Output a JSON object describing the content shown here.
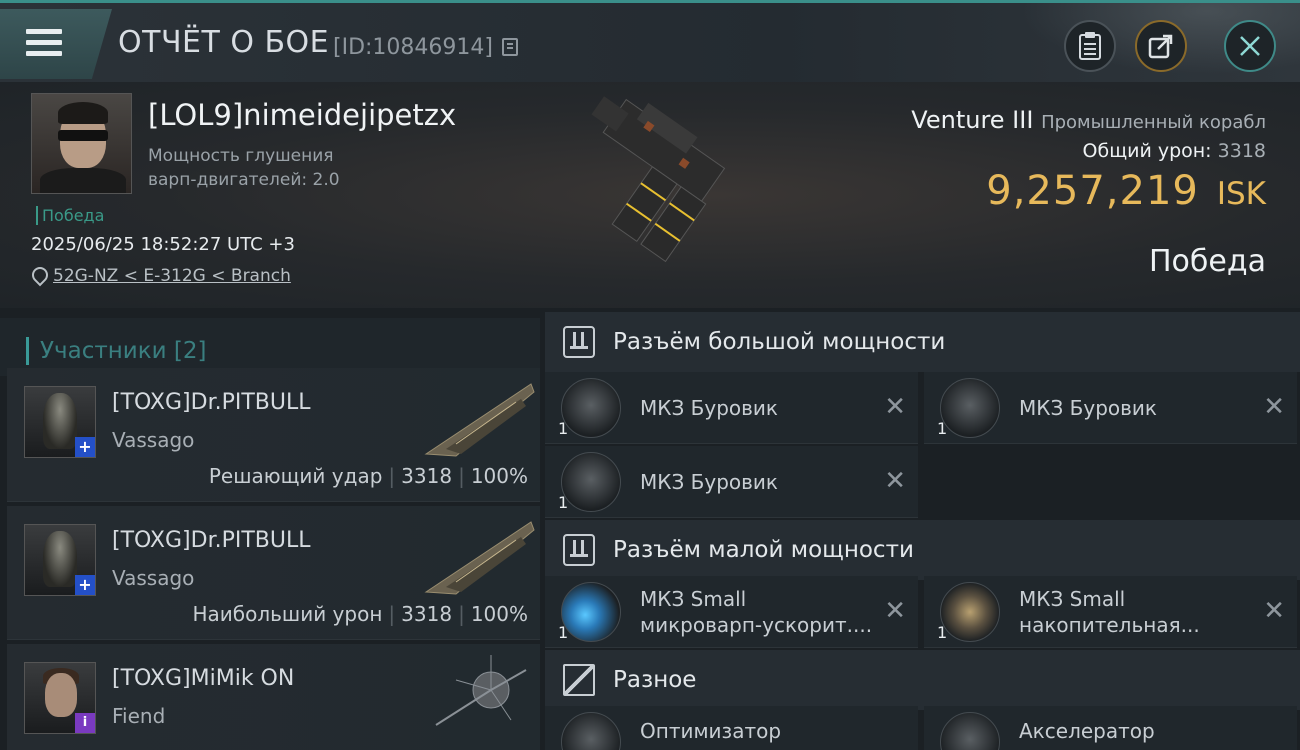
{
  "header": {
    "title": "ОТЧЁТ О БОЕ",
    "report_id": "[ID:10846914]"
  },
  "victim": {
    "name": "[LOL9]nimeidejipetzx",
    "attribute_line1": "Мощность глушения",
    "attribute_line2": "варп-двигателей: 2.0",
    "status_tag": "Победа",
    "datetime": "2025/06/25 18:52:27 UTC +3",
    "location": "52G-NZ < E-312G < Branch",
    "ship_name": "Venture III",
    "ship_class": "Промышленный корабл",
    "total_damage_label": "Общий урон:",
    "total_damage_value": "3318",
    "isk_value": "9,257,219",
    "isk_currency": "ISK",
    "result": "Победа"
  },
  "participants": {
    "title": "Участники [2]",
    "list": [
      {
        "name": "[TOXG]Dr.PITBULL",
        "ship": "Vassago",
        "role": "Решающий удар",
        "damage": "3318",
        "percent": "100%",
        "badge": "+",
        "badge_color": "#2450c8"
      },
      {
        "name": "[TOXG]Dr.PITBULL",
        "ship": "Vassago",
        "role": "Наибольший урон",
        "damage": "3318",
        "percent": "100%",
        "badge": "+",
        "badge_color": "#2450c8"
      },
      {
        "name": "[TOXG]MiMik ON",
        "ship": "Fiend",
        "badge": "i",
        "badge_color": "#7a3ac0"
      }
    ]
  },
  "fitting": {
    "high_slots": {
      "title": "Разъём большой мощности",
      "modules": [
        {
          "name": "МКЗ Буровик",
          "qty": "1"
        },
        {
          "name": "МКЗ Буровик",
          "qty": "1"
        },
        {
          "name": "МКЗ Буровик",
          "qty": "1"
        }
      ]
    },
    "low_slots": {
      "title": "Разъём малой мощности",
      "modules": [
        {
          "name_line1": "МКЗ Small",
          "name_line2": "микроварп-ускорит....",
          "qty": "1"
        },
        {
          "name_line1": "МКЗ Small",
          "name_line2": "накопительная...",
          "qty": "1"
        }
      ]
    },
    "misc": {
      "title": "Разное",
      "modules": [
        {
          "name": "Оптимизатор"
        },
        {
          "name": "Акселератор"
        }
      ]
    }
  },
  "colors": {
    "accent_teal": "#3a9a98",
    "isk_gold": "#e7b95b",
    "background": "#1a1f24"
  }
}
